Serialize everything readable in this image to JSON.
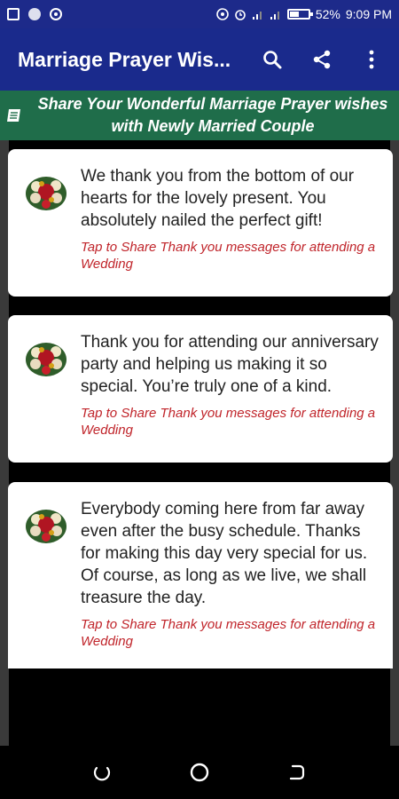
{
  "status_bar": {
    "battery_percent": "52%",
    "battery_level": 0.52,
    "time": "9:09 PM",
    "icons": [
      "gallery-icon",
      "dot-icon",
      "record-icon",
      "hotspot-icon",
      "alarm-icon",
      "signal-icon",
      "signal-icon",
      "battery-icon"
    ]
  },
  "app_bar": {
    "title": "Marriage Prayer Wis...",
    "actions": [
      "search-icon",
      "share-icon",
      "more-vert-icon"
    ]
  },
  "banner": {
    "icon": "document-icon",
    "text": "Share Your Wonderful Marriage Prayer wishes with Newly Married Couple"
  },
  "cards": [
    {
      "icon": "bouquet-icon",
      "message": "We thank you from the bottom of our hearts for the lovely present. You absolutely nailed the perfect gift!",
      "hint": "Tap to Share Thank you messages for attending a Wedding"
    },
    {
      "icon": "bouquet-icon",
      "message": "Thank you for attending our anniversary party and helping us making it so special. You’re truly one of a kind.",
      "hint": "Tap to Share Thank you messages for attending a Wedding"
    },
    {
      "icon": "bouquet-icon",
      "message": "Everybody coming here from far away even after the busy schedule. Thanks for making this day very special for us. Of course, as long as we live, we shall treasure the day.",
      "hint": "Tap to Share Thank you messages for attending a Wedding"
    }
  ],
  "nav_bar": {
    "buttons": [
      "recents-icon",
      "home-icon",
      "back-icon"
    ]
  },
  "colors": {
    "app_bar": "#1a2a8c",
    "banner": "#1f6d4a",
    "hint": "#c0242a"
  }
}
